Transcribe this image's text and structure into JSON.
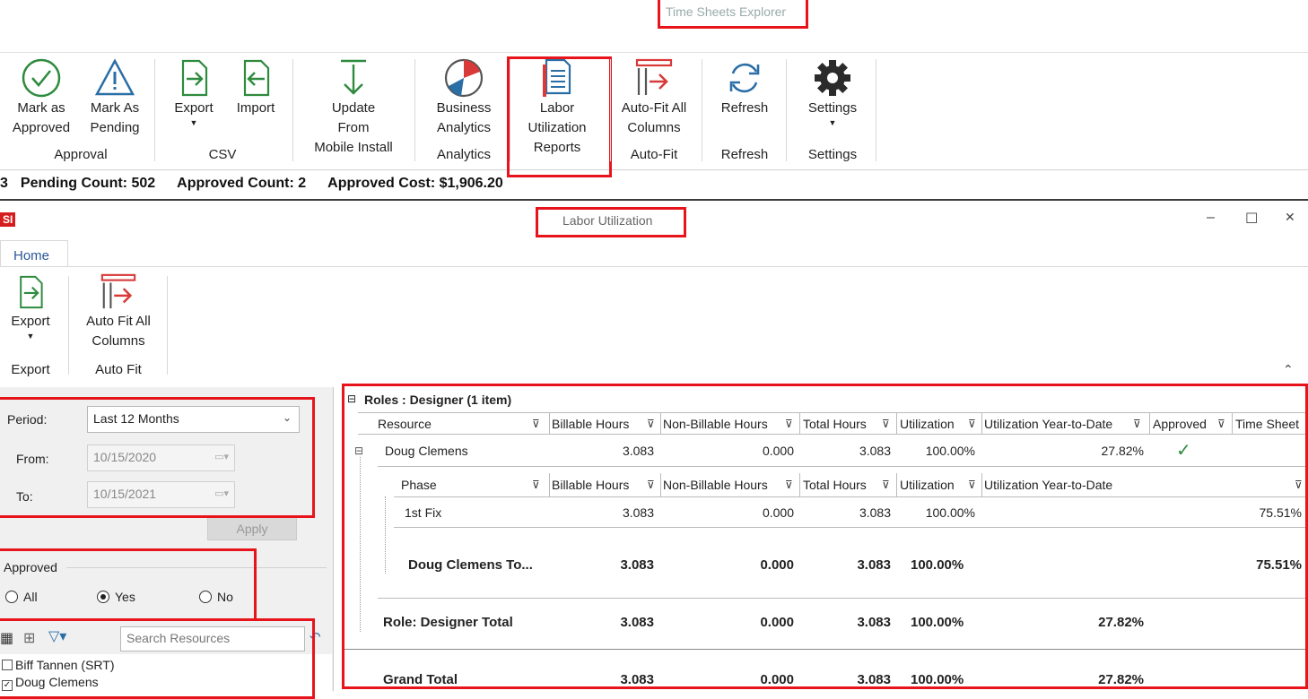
{
  "top_window": {
    "title": "Time Sheets Explorer"
  },
  "main_ribbon": {
    "buttons": {
      "mark_approved": [
        "Mark as",
        "Approved"
      ],
      "mark_pending": [
        "Mark As",
        "Pending"
      ],
      "export": [
        "Export"
      ],
      "import": [
        "Import"
      ],
      "update": [
        "Update",
        "From",
        "Mobile Install"
      ],
      "business_analytics": [
        "Business",
        "Analytics"
      ],
      "labor_util": [
        "Labor",
        "Utilization",
        "Reports"
      ],
      "autofit": [
        "Auto-Fit All",
        "Columns"
      ],
      "refresh": [
        "Refresh"
      ],
      "settings": [
        "Settings"
      ]
    },
    "groups": {
      "approval": "Approval",
      "csv": "CSV",
      "analytics": "Analytics",
      "autofit": "Auto-Fit",
      "refresh": "Refresh",
      "settings": "Settings"
    }
  },
  "status_bar": {
    "leading": "3",
    "pending": "Pending Count: 502",
    "approved": "Approved Count: 2",
    "cost": "Approved Cost: $1,906.20"
  },
  "inner_window": {
    "logo": "SI",
    "title": "Labor Utilization",
    "minimize": "–",
    "maximize": "☐",
    "close": "✕",
    "tab_home": "Home",
    "ribbon": {
      "export": "Export",
      "autofit_line1": "Auto Fit All",
      "autofit_line2": "Columns",
      "group_export": "Export",
      "group_autofit": "Auto Fit"
    }
  },
  "filters": {
    "period_label": "Period:",
    "period_value": "Last 12 Months",
    "from_label": "From:",
    "from_value": "10/15/2020",
    "to_label": "To:",
    "to_value": "10/15/2021",
    "apply": "Apply",
    "approved_label": "Approved",
    "approved_options": [
      "All",
      "Yes",
      "No"
    ],
    "approved_selected": "Yes",
    "search_placeholder": "Search Resources",
    "resources": [
      {
        "name": "Biff Tannen (SRT)",
        "checked": false
      },
      {
        "name": "Doug Clemens",
        "checked": true
      }
    ]
  },
  "grid": {
    "group_header": "Roles : Designer (1 item)",
    "columns": [
      "Resource",
      "Billable Hours",
      "Non-Billable Hours",
      "Total Hours",
      "Utilization",
      "Utilization Year-to-Date",
      "Approved",
      "Time Sheet"
    ],
    "resource_row": {
      "resource": "Doug Clemens",
      "billable": "3.083",
      "nonbillable": "0.000",
      "total": "3.083",
      "utilization": "100.00%",
      "ytd": "27.82%",
      "approved": "✓"
    },
    "phase_columns": [
      "Phase",
      "Billable Hours",
      "Non-Billable Hours",
      "Total Hours",
      "Utilization",
      "Utilization Year-to-Date"
    ],
    "phase_row": {
      "phase": "1st Fix",
      "billable": "3.083",
      "nonbillable": "0.000",
      "total": "3.083",
      "utilization": "100.00%",
      "last": "75.51%"
    },
    "resource_total": {
      "label": "Doug Clemens To...",
      "billable": "3.083",
      "nonbillable": "0.000",
      "total": "3.083",
      "utilization": "100.00%",
      "last": "75.51%"
    },
    "role_total": {
      "label": "Role: Designer Total",
      "billable": "3.083",
      "nonbillable": "0.000",
      "total": "3.083",
      "utilization": "100.00%",
      "ytd": "27.82%"
    },
    "grand_total": {
      "label": "Grand Total",
      "billable": "3.083",
      "nonbillable": "0.000",
      "total": "3.083",
      "utilization": "100.00%",
      "ytd": "27.82%"
    }
  }
}
